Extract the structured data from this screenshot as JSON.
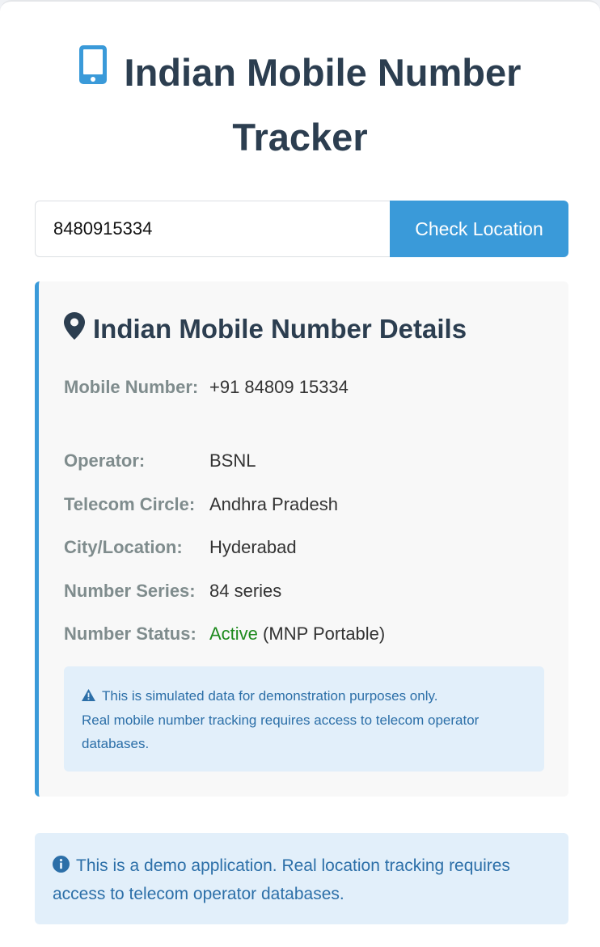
{
  "header": {
    "title": "Indian Mobile Number Tracker",
    "icon": "mobile-phone-icon"
  },
  "search": {
    "value": "8480915334",
    "button_label": "Check Location"
  },
  "details": {
    "heading": "Indian Mobile Number Details",
    "heading_icon": "map-marker-icon",
    "rows": [
      {
        "label": "Mobile Number:",
        "value": "+91 84809 15334"
      },
      {
        "label": "Operator:",
        "value": "BSNL"
      },
      {
        "label": "Telecom Circle:",
        "value": "Andhra Pradesh"
      },
      {
        "label": "City/Location:",
        "value": "Hyderabad"
      },
      {
        "label": "Number Series:",
        "value": "84 series"
      },
      {
        "label": "Number Status:",
        "status": "Active",
        "status_note": "(MNP Portable)"
      }
    ],
    "warning": {
      "icon": "warning-triangle-icon",
      "line1": "This is simulated data for demonstration purposes only.",
      "line2": "Real mobile number tracking requires access to telecom operator databases."
    }
  },
  "info": {
    "icon": "info-circle-icon",
    "text": "This is a demo application. Real location tracking requires access to telecom operator databases."
  },
  "colors": {
    "accent": "#3a9ad9",
    "heading": "#2c3e50",
    "label": "#7f8c8d",
    "active": "#1e8a1e",
    "info_bg": "#e2effa",
    "info_text": "#2c6fa8"
  }
}
